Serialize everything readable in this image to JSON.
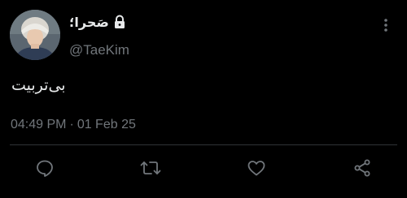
{
  "tweet": {
    "author_name": "صَحرا؛",
    "handle": "@TaeKim",
    "text": "بی‌تربیت",
    "time": "04:49 PM",
    "separator": "·",
    "date": "01 Feb 25"
  },
  "icons": {
    "lock": "lock-icon",
    "more": "more-vertical-icon",
    "reply": "reply-icon",
    "retweet": "retweet-icon",
    "like": "heart-icon",
    "share": "share-icon"
  },
  "colors": {
    "background": "#000000",
    "text_primary": "#e7e9ea",
    "text_secondary": "#71767b",
    "divider": "#2f3336"
  }
}
